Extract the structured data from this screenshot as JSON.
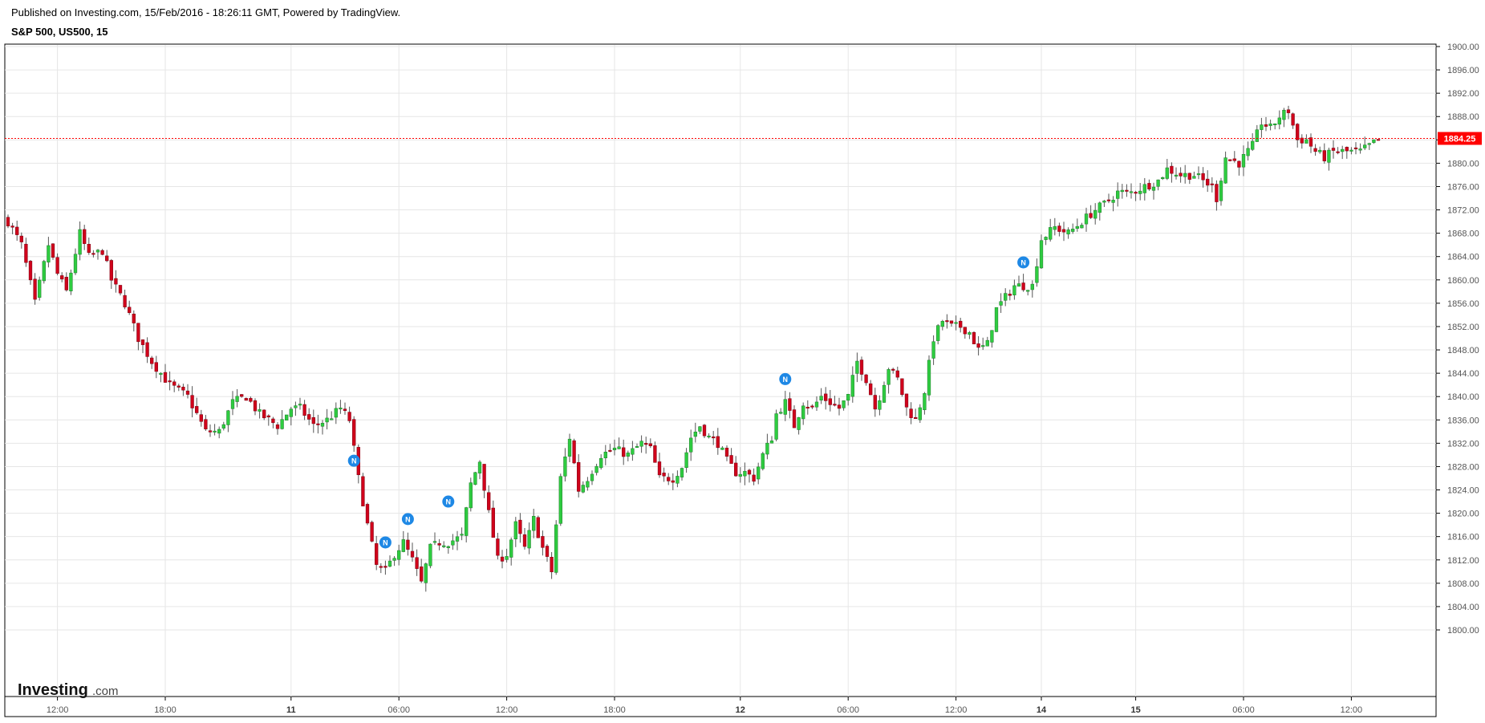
{
  "header": {
    "published": "Published on Investing.com, 15/Feb/2016 - 18:26:11 GMT, Powered by TradingView.",
    "title": "S&P 500, US500, 15"
  },
  "logo": {
    "brand": "Investing",
    "suffix": ".com"
  },
  "colors": {
    "up": "#2ecc40",
    "down": "#d0021b",
    "wick": "#555555",
    "grid": "#e6e6e6",
    "last_price": "#ff0000",
    "news": "#1e88e5"
  },
  "chart_data": {
    "type": "candlestick",
    "timeframe": "15",
    "symbol": "US500",
    "name": "S&P 500",
    "ylim": [
      1798,
      1901
    ],
    "y_ticks": [
      1900,
      1896,
      1892,
      1888,
      1884,
      1880,
      1876,
      1872,
      1868,
      1864,
      1860,
      1856,
      1852,
      1848,
      1844,
      1840,
      1836,
      1832,
      1828,
      1824,
      1820,
      1816,
      1812,
      1808,
      1804,
      1800
    ],
    "y_tick_labels": [
      "1900.00",
      "1896.00",
      "1892.00",
      "1888.00",
      "1884.00",
      "1880.00",
      "1876.00",
      "1872.00",
      "1868.00",
      "1864.00",
      "1860.00",
      "1856.00",
      "1852.00",
      "1848.00",
      "1844.00",
      "1840.00",
      "1836.00",
      "1832.00",
      "1828.00",
      "1824.00",
      "1820.00",
      "1816.00",
      "1812.00",
      "1808.00",
      "1804.00",
      "1800.00"
    ],
    "x_ticks": [
      {
        "label": "12:00",
        "bar": 11,
        "bold": false
      },
      {
        "label": "18:00",
        "bar": 35,
        "bold": false
      },
      {
        "label": "11",
        "bar": 63,
        "bold": true
      },
      {
        "label": "06:00",
        "bar": 87,
        "bold": false
      },
      {
        "label": "12:00",
        "bar": 111,
        "bold": false
      },
      {
        "label": "18:00",
        "bar": 135,
        "bold": false
      },
      {
        "label": "12",
        "bar": 163,
        "bold": true
      },
      {
        "label": "06:00",
        "bar": 187,
        "bold": false
      },
      {
        "label": "12:00",
        "bar": 211,
        "bold": false
      },
      {
        "label": "14",
        "bar": 230,
        "bold": true
      },
      {
        "label": "15",
        "bar": 251,
        "bold": true
      },
      {
        "label": "06:00",
        "bar": 275,
        "bold": false
      },
      {
        "label": "12:00",
        "bar": 299,
        "bold": false
      }
    ],
    "last_price": 1884.25,
    "last_price_label": "1884.25",
    "news_markers": [
      {
        "bar": 77,
        "y": 1829,
        "label": "N"
      },
      {
        "bar": 84,
        "y": 1815,
        "label": "N"
      },
      {
        "bar": 89,
        "y": 1819,
        "label": "N"
      },
      {
        "bar": 98,
        "y": 1822,
        "label": "N"
      },
      {
        "bar": 173,
        "y": 1843,
        "label": "N"
      },
      {
        "bar": 226,
        "y": 1863,
        "label": "N"
      }
    ],
    "close_anchors": [
      [
        0,
        1870
      ],
      [
        3,
        1866
      ],
      [
        6,
        1856
      ],
      [
        9,
        1866
      ],
      [
        11,
        1861
      ],
      [
        13,
        1858
      ],
      [
        16,
        1868
      ],
      [
        18,
        1864
      ],
      [
        21,
        1865
      ],
      [
        23,
        1860
      ],
      [
        26,
        1856
      ],
      [
        29,
        1850
      ],
      [
        32,
        1846
      ],
      [
        36,
        1842
      ],
      [
        40,
        1840
      ],
      [
        44,
        1834
      ],
      [
        47,
        1834
      ],
      [
        50,
        1839
      ],
      [
        53,
        1840
      ],
      [
        56,
        1837
      ],
      [
        60,
        1835
      ],
      [
        63,
        1838
      ],
      [
        65,
        1838
      ],
      [
        68,
        1835
      ],
      [
        71,
        1836
      ],
      [
        74,
        1838
      ],
      [
        76,
        1836
      ],
      [
        78,
        1826
      ],
      [
        80,
        1818
      ],
      [
        82,
        1811
      ],
      [
        84,
        1810
      ],
      [
        86,
        1813
      ],
      [
        88,
        1815
      ],
      [
        90,
        1812
      ],
      [
        92,
        1808
      ],
      [
        94,
        1814
      ],
      [
        96,
        1815
      ],
      [
        98,
        1815
      ],
      [
        101,
        1816
      ],
      [
        103,
        1825
      ],
      [
        105,
        1829
      ],
      [
        107,
        1820
      ],
      [
        109,
        1812
      ],
      [
        111,
        1813
      ],
      [
        113,
        1818
      ],
      [
        115,
        1814
      ],
      [
        117,
        1819
      ],
      [
        119,
        1814
      ],
      [
        121,
        1810
      ],
      [
        123,
        1826
      ],
      [
        125,
        1833
      ],
      [
        127,
        1824
      ],
      [
        129,
        1826
      ],
      [
        132,
        1830
      ],
      [
        135,
        1831
      ],
      [
        138,
        1830
      ],
      [
        141,
        1832
      ],
      [
        143,
        1831
      ],
      [
        145,
        1826
      ],
      [
        148,
        1826
      ],
      [
        150,
        1828
      ],
      [
        152,
        1833
      ],
      [
        154,
        1835
      ],
      [
        156,
        1833
      ],
      [
        158,
        1832
      ],
      [
        160,
        1829
      ],
      [
        162,
        1827
      ],
      [
        164,
        1827
      ],
      [
        166,
        1826
      ],
      [
        168,
        1830
      ],
      [
        170,
        1833
      ],
      [
        171,
        1837
      ],
      [
        173,
        1839
      ],
      [
        175,
        1835
      ],
      [
        177,
        1839
      ],
      [
        179,
        1838
      ],
      [
        181,
        1840
      ],
      [
        183,
        1839
      ],
      [
        185,
        1838
      ],
      [
        187,
        1840
      ],
      [
        189,
        1846
      ],
      [
        191,
        1843
      ],
      [
        193,
        1838
      ],
      [
        194,
        1840
      ],
      [
        196,
        1845
      ],
      [
        198,
        1843
      ],
      [
        200,
        1838
      ],
      [
        202,
        1836
      ],
      [
        204,
        1841
      ],
      [
        206,
        1850
      ],
      [
        208,
        1853
      ],
      [
        210,
        1852
      ],
      [
        212,
        1852
      ],
      [
        214,
        1851
      ],
      [
        216,
        1848
      ],
      [
        218,
        1849
      ],
      [
        220,
        1855
      ],
      [
        222,
        1857
      ],
      [
        224,
        1859
      ],
      [
        226,
        1859
      ],
      [
        228,
        1859
      ],
      [
        230,
        1867
      ],
      [
        233,
        1869
      ],
      [
        236,
        1868
      ],
      [
        239,
        1870
      ],
      [
        242,
        1872
      ],
      [
        244,
        1873
      ],
      [
        247,
        1875
      ],
      [
        250,
        1875
      ],
      [
        253,
        1876
      ],
      [
        256,
        1877
      ],
      [
        258,
        1879
      ],
      [
        261,
        1878
      ],
      [
        264,
        1878
      ],
      [
        266,
        1877
      ],
      [
        268,
        1876
      ],
      [
        269,
        1874
      ],
      [
        271,
        1881
      ],
      [
        274,
        1880
      ],
      [
        277,
        1883
      ],
      [
        279,
        1887
      ],
      [
        281,
        1886
      ],
      [
        283,
        1888
      ],
      [
        285,
        1889
      ],
      [
        287,
        1884
      ],
      [
        289,
        1884
      ],
      [
        291,
        1882
      ],
      [
        293,
        1881
      ],
      [
        295,
        1882
      ],
      [
        297,
        1882
      ],
      [
        299,
        1882
      ],
      [
        301,
        1882
      ],
      [
        303,
        1883
      ],
      [
        305,
        1884
      ]
    ]
  }
}
